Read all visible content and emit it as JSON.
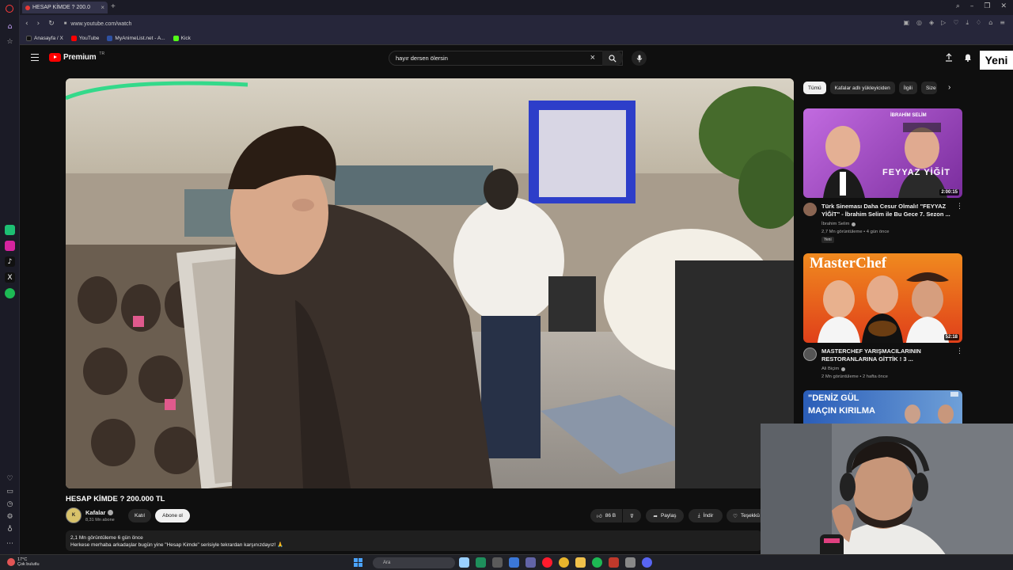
{
  "browser": {
    "tab_title": "HESAP KİMDE ? 200.0",
    "url": "www.youtube.com/watch",
    "bookmarks": [
      {
        "label": "Anasayfa / X",
        "color": "#111111"
      },
      {
        "label": "YouTube",
        "color": "#ff0000"
      },
      {
        "label": "MyAnimeList.net - A...",
        "color": "#2e51a2"
      },
      {
        "label": "Kick",
        "color": "#53fc18"
      }
    ]
  },
  "youtube": {
    "logo_text": "Premium",
    "logo_country": "TR",
    "search_query": "hayır dersen ölersin",
    "new_badge": "Yeni"
  },
  "video": {
    "title": "HESAP KİMDE ? 200.000 TL",
    "channel": {
      "name": "Kafalar",
      "subscribers": "8,31 Mn abone",
      "avatar_text": "K"
    },
    "join_label": "Katıl",
    "subscribe_label": "Abone ol",
    "likes": "86 B",
    "share_label": "Paylaş",
    "download_label": "İndir",
    "thanks_label": "Teşekkü",
    "views_line": "2,1 Mn görüntüleme  6 gün önce",
    "description": "Herkese merhaba arkadaşlar bugün yine \"Hesap Kimde\" serisiyle tekrardan karşınızdayız! 🙏"
  },
  "chips": [
    "Tümü",
    "Kafalar adlı yükleyiciden",
    "İlgili",
    "Size"
  ],
  "recommendations": [
    {
      "title": "Türk Sineması Daha Cesur Olmalı! \"FEYYAZ YİĞİT\" - İbrahim Selim ile Bu Gece 7. Sezon ...",
      "channel": "İbrahim Selim",
      "meta": "2,7 Mn görüntüleme • 4 gün önce",
      "badge": "Yeni",
      "duration": "2:00:15",
      "thumb_text_top": "İBRAHİM SELİM",
      "thumb_text_bottom": "FEYYAZ YİĞİT",
      "accent": "#a64fc9"
    },
    {
      "title": "MASTERCHEF YARIŞMACILARININ RESTORANLARINA GİTTİK ! 3 ...",
      "channel": "Ali Biçim",
      "meta": "2 Mn görüntüleme • 2 hafta önce",
      "duration": "52:18",
      "thumb_text_top": "MasterChef",
      "accent": "#e04a1b"
    },
    {
      "thumb_text_top": "\"DENİZ GÜL",
      "thumb_text_bottom": "MAÇIN KIRILMA",
      "accent": "#1f5aa6"
    }
  ],
  "taskbar": {
    "weather_temp": "17°C",
    "weather_desc": "Çok bulutlu",
    "search_placeholder": "Ara"
  },
  "colors": {
    "brand": "#ff0000",
    "background": "#0f0f0f",
    "chip_bg": "#272727"
  }
}
